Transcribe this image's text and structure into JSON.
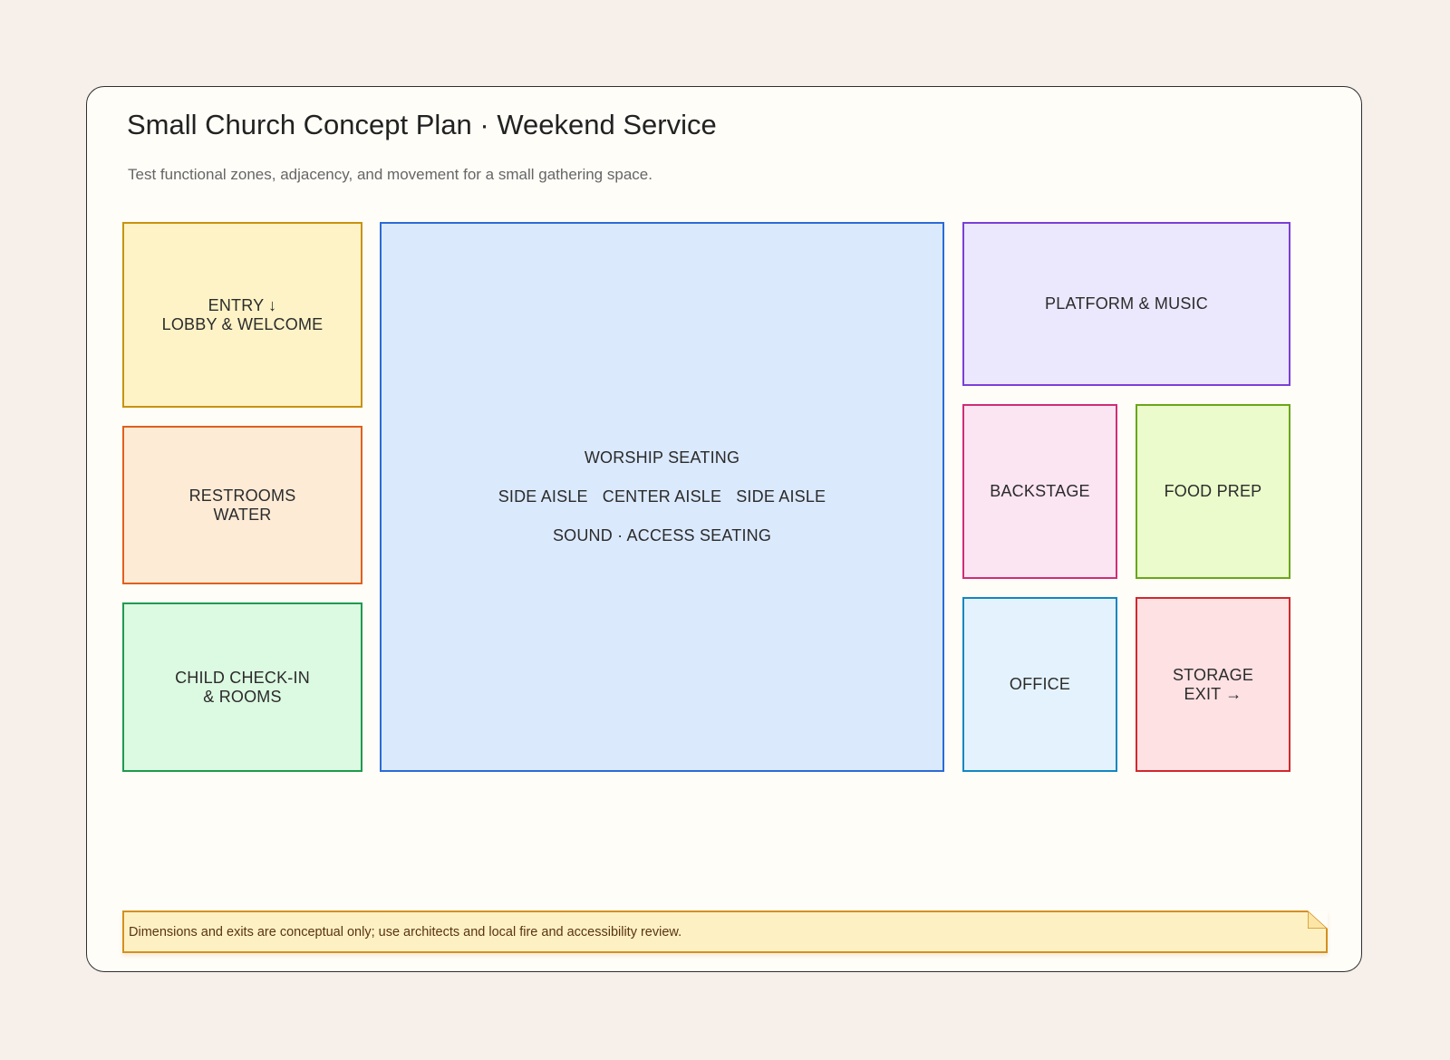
{
  "title": "Small Church Concept Plan · Weekend Service",
  "subtitle": "Test functional zones, adjacency, and movement for a small gathering space.",
  "zones": {
    "entry": {
      "lines": [
        "ENTRY ↓",
        "LOBBY & WELCOME"
      ],
      "color": "#c8920f",
      "fill": "#fdf3c6"
    },
    "restrooms": {
      "lines": [
        "RESTROOMS",
        "WATER"
      ],
      "color": "#e0601e",
      "fill": "#fdebd6"
    },
    "child": {
      "lines": [
        "CHILD CHECK-IN",
        "& ROOMS"
      ],
      "color": "#1f9a4e",
      "fill": "#dcf9e2"
    },
    "worship": {
      "heading": "WORSHIP SEATING",
      "aisles": [
        "SIDE AISLE",
        "CENTER AISLE",
        "SIDE AISLE"
      ],
      "footer": "SOUND · ACCESS SEATING",
      "color": "#2b6bd6",
      "fill": "#dbe9fd"
    },
    "platform": {
      "lines": [
        "PLATFORM & MUSIC"
      ],
      "color": "#7a3fd8",
      "fill": "#ebe7fd"
    },
    "backstage": {
      "lines": [
        "BACKSTAGE"
      ],
      "color": "#cf2d78",
      "fill": "#fbe5f2"
    },
    "food": {
      "lines": [
        "FOOD PREP"
      ],
      "color": "#6aa61a",
      "fill": "#ebfbcb"
    },
    "office": {
      "lines": [
        "OFFICE"
      ],
      "color": "#1287c0",
      "fill": "#e4f2fd"
    },
    "storage": {
      "lines": [
        "STORAGE",
        "EXIT →"
      ],
      "color": "#d1292e",
      "fill": "#fde1e3"
    }
  },
  "note": "Dimensions and exits are conceptual only; use architects and local fire and accessibility review."
}
